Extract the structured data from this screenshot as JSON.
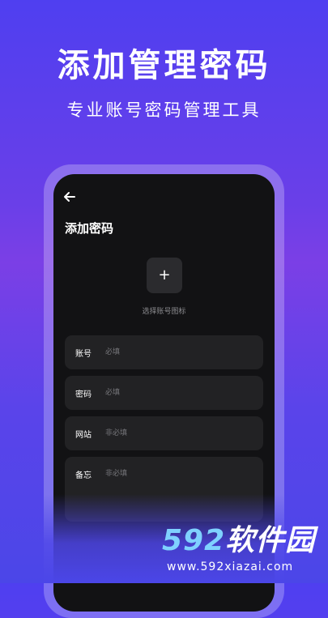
{
  "hero": {
    "title": "添加管理密码",
    "subtitle": "专业账号密码管理工具"
  },
  "screen": {
    "page_title": "添加密码",
    "icon_picker": {
      "plus": "+",
      "label": "选择账号图标"
    },
    "fields": [
      {
        "label": "账号",
        "placeholder": "必填",
        "value": ""
      },
      {
        "label": "密码",
        "placeholder": "必填",
        "value": ""
      },
      {
        "label": "网站",
        "placeholder": "非必填",
        "value": ""
      },
      {
        "label": "备忘",
        "placeholder": "非必填",
        "value": ""
      }
    ]
  },
  "watermark": {
    "number": "592",
    "text": "软件园",
    "url": "www.592xiazai.com"
  },
  "colors": {
    "background_top": "#4f3ff0",
    "background_mid": "#7b3fe6",
    "screen_bg": "#121214",
    "field_bg": "#222224",
    "placeholder": "#77777b"
  }
}
